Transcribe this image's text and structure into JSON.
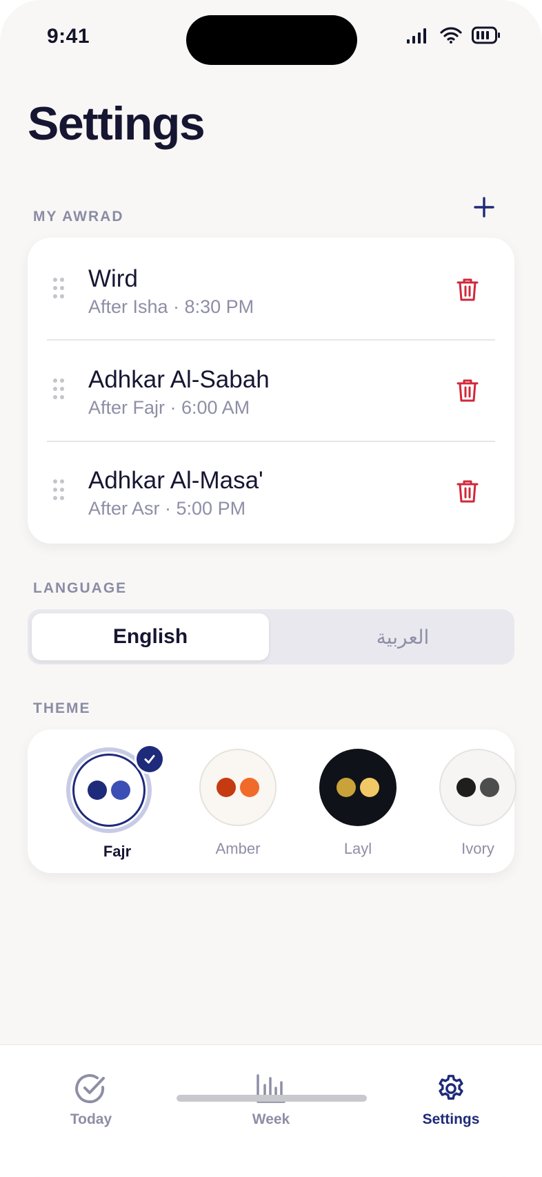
{
  "status_bar": {
    "time": "9:41"
  },
  "page": {
    "title": "Settings"
  },
  "awrad": {
    "section_label": "MY AWRAD",
    "items": [
      {
        "title": "Wird",
        "subtitle": "After Isha · 8:30 PM"
      },
      {
        "title": "Adhkar Al-Sabah",
        "subtitle": "After Fajr · 6:00 AM"
      },
      {
        "title": "Adhkar Al-Masa'",
        "subtitle": "After Asr · 5:00 PM"
      }
    ]
  },
  "language": {
    "section_label": "LANGUAGE",
    "options": [
      "English",
      "العربية"
    ],
    "selected": "English"
  },
  "theme": {
    "section_label": "THEME",
    "selected": "Fajr",
    "swatches": [
      {
        "name": "Fajr",
        "bg": "#ffffff",
        "dot1": "#1e2a7a",
        "dot2": "#3b4fb5"
      },
      {
        "name": "Amber",
        "bg": "#faf6f2",
        "dot1": "#c53a10",
        "dot2": "#f06a2a"
      },
      {
        "name": "Layl",
        "bg": "#0f1218",
        "dot1": "#c9a23a",
        "dot2": "#f0c866"
      },
      {
        "name": "Ivory",
        "bg": "#f6f5f3",
        "dot1": "#1e1e1e",
        "dot2": "#4d4d4d"
      }
    ]
  },
  "tabs": [
    {
      "label": "Today",
      "icon": "check-circle-icon"
    },
    {
      "label": "Week",
      "icon": "bar-chart-icon"
    },
    {
      "label": "Settings",
      "icon": "gear-icon",
      "active": true
    }
  ],
  "colors": {
    "accent": "#1e2a7a",
    "danger": "#d0283a",
    "muted": "#8e8ea6",
    "text": "#161632"
  }
}
